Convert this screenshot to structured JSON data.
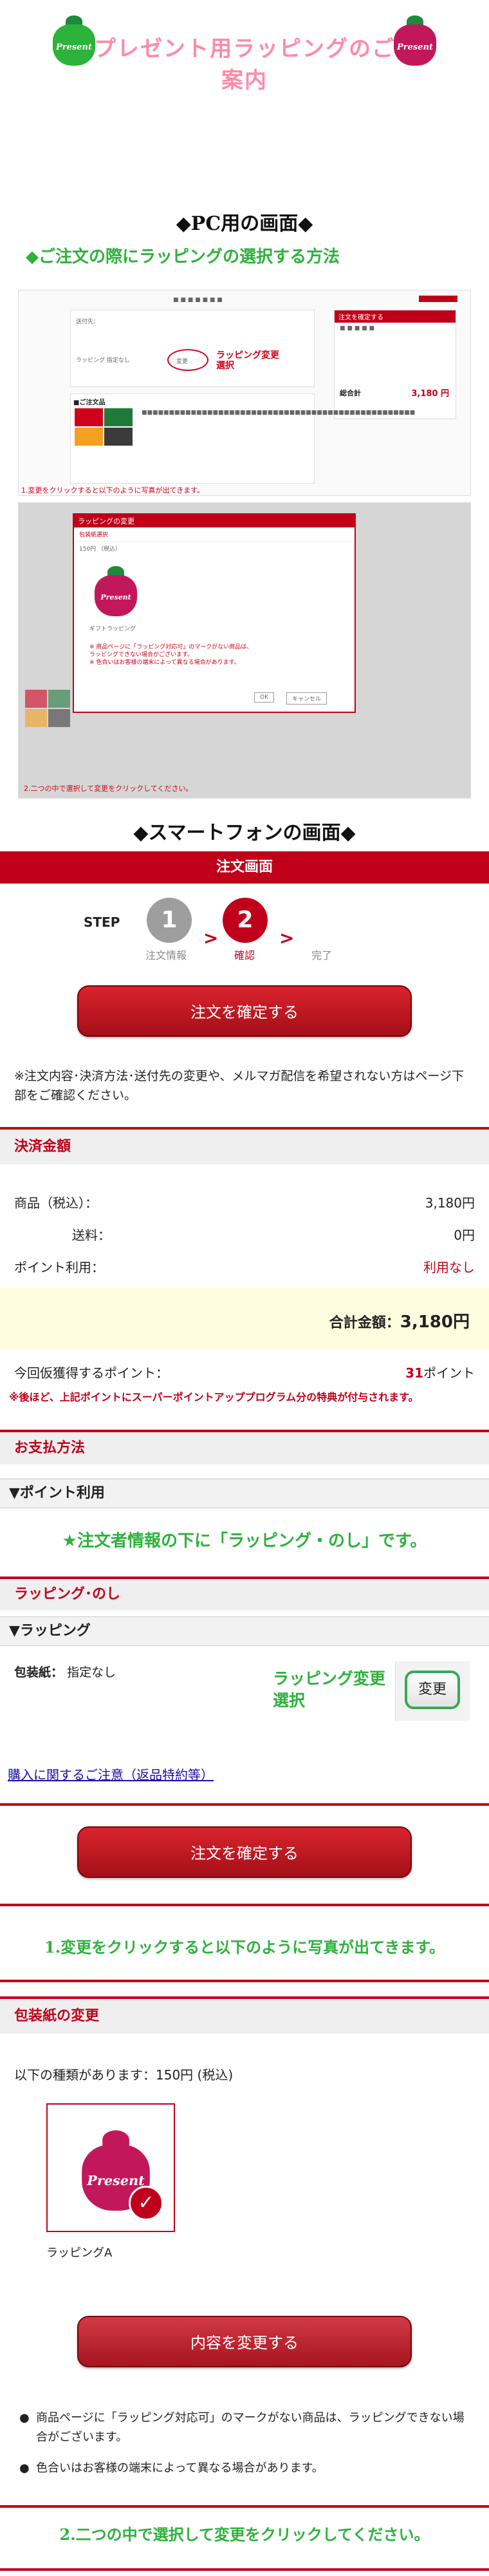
{
  "header": {
    "title": "プレゼント用ラッピングのご案内",
    "bag_label": "Present",
    "colors": {
      "green": "#1e8a3c",
      "pink": "#ff8aa8",
      "bag_left": "#2db23c",
      "bag_right": "#c2185b"
    }
  },
  "pc_section": {
    "title": "◆PC用の画面◆",
    "subtitle": "◆ご注文の際にラッピングの選択する方法",
    "shot1": {
      "wrap_label": "ラッピング 指定なし",
      "change_btn": "変更",
      "annotation": "ラッピング変更\n選択",
      "order_box_head": "注文を確定する",
      "total_label": "総合計",
      "total_value": "3,180 円",
      "product_title": "■ご注文品"
    },
    "caption1": "1.変更をクリックすると以下のように写真が出てきます。",
    "shot2": {
      "modal_title": "ラッピングの変更",
      "modal_sub": "包装紙選択",
      "price": "150円 （税込）",
      "item_label": "ギフトラッピング",
      "cancel": "キャンセル",
      "ok": "OK",
      "notes": [
        "※ 商品ページに「ラッピング対応可」のマークがない商品は、",
        "ラッピングできない場合がございます。",
        "※ 色合いはお客様の端末によって異なる場合があります。"
      ]
    },
    "caption2": "2.二つの中で選択して変更をクリックしてください。"
  },
  "sp_section": {
    "title": "◆スマートフォンの画面◆",
    "header": "注文画面",
    "step_label": "STEP",
    "steps": [
      {
        "num": "1",
        "label": "注文情報"
      },
      {
        "num": "2",
        "label": "確認"
      },
      {
        "num": "",
        "label": "完了"
      }
    ],
    "confirm_btn": "注文を確定する",
    "notice": "※注文内容･決済方法･送付先の変更や、メルマガ配信を希望されない方はページ下部をご確認ください。",
    "payment_head": "決済金額",
    "rows": [
      {
        "label": "商品（税込）：",
        "value": "3,180円"
      },
      {
        "label": "送料：",
        "value": "0円"
      },
      {
        "label": "ポイント利用：",
        "value": "利用なし"
      }
    ],
    "total_label": "合計金額：",
    "total_value": "3,180円",
    "points_label": "今回仮獲得するポイント：",
    "points_value": "31",
    "points_unit": "ポイント",
    "points_note": "※後ほど、上記ポイントにスーパーポイントアッププログラム分の特典が付与されます。",
    "pay_method_head": "お支払方法",
    "point_use": "▼ポイント利用",
    "green_note": "★注文者情報の下に「ラッピング・のし」です。",
    "wrap_head": "ラッピング･のし",
    "wrap_sub": "▼ラッピング",
    "wrap_paper_label": "包装紙：",
    "wrap_paper_value": "指定なし",
    "wrap_annotation": "ラッピング変更\n選択",
    "change_btn": "変更",
    "purchase_note": "購入に関するご注意（返品特約等）",
    "caption1": "1.変更をクリックすると以下のように写真が出てきます。",
    "paper_change_head": "包装紙の変更",
    "options_text": "以下の種類があります：150円 (税込)",
    "option_label": "ラッピングA",
    "change_content_btn": "内容を変更する",
    "bullets": [
      "商品ページに「ラッピング対応可」のマークがない商品は、ラッピングできない場合がございます。",
      "色合いはお客様の端末によって異なる場合があります。"
    ],
    "caption2": "2.二つの中で選択して変更をクリックしてください。"
  }
}
